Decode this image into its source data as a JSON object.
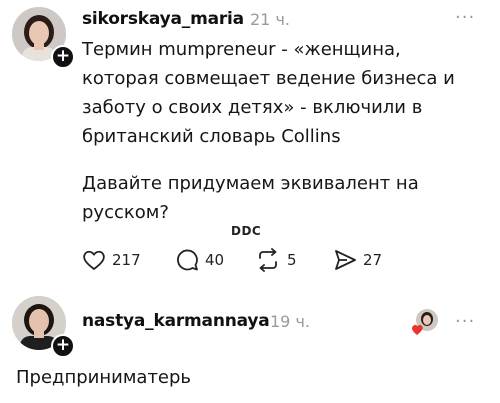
{
  "post": {
    "username": "sikorskaya_maria",
    "time": "21 ч.",
    "text": "Термин mumpreneur - «женщина,\nкоторая совмещает ведение бизнеса и\nзаботу о своих детях» - включили в\nбританский словарь Collins",
    "text2": "Давайте придумаем эквивалент на\nрусском?",
    "likes": "217",
    "comments": "40",
    "reposts": "5",
    "shares": "27",
    "watermark": "DDC",
    "more_icon": "more-dots-icon"
  },
  "reply": {
    "username": "nastya_karmannaya",
    "time": "19 ч.",
    "text": "Предприниматерь"
  }
}
